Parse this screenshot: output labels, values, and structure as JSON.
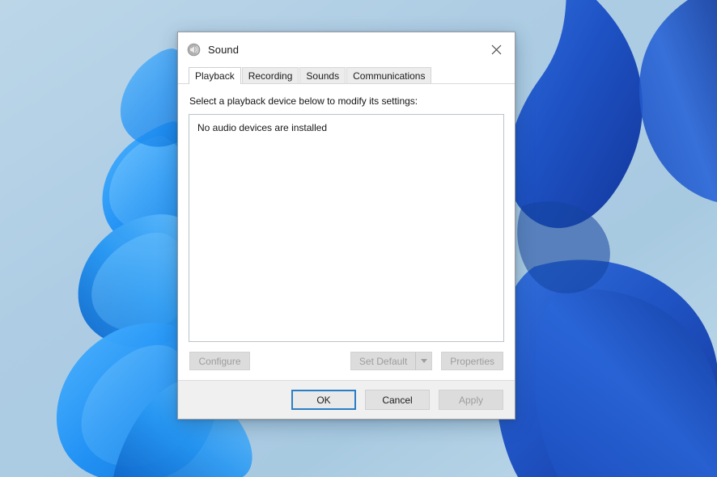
{
  "desktop": {
    "wallpaper_name": "windows-11-bloom-wallpaper",
    "background_top": "#b9d3e6",
    "background_bottom": "#bcd7e8",
    "bloom_light": "#2c9cf5",
    "bloom_mid": "#1f7ae0",
    "bloom_dark": "#1447bd"
  },
  "dialog": {
    "title": "Sound",
    "icon": "speaker-icon",
    "close_label": "Close",
    "tabs": [
      {
        "label": "Playback",
        "active": true
      },
      {
        "label": "Recording",
        "active": false
      },
      {
        "label": "Sounds",
        "active": false
      },
      {
        "label": "Communications",
        "active": false
      }
    ],
    "content": {
      "prompt": "Select a playback device below to modify its settings:",
      "device_list": {
        "items": [],
        "empty_message": "No audio devices are installed"
      }
    },
    "actions": {
      "configure": {
        "label": "Configure",
        "enabled": false
      },
      "set_default": {
        "label": "Set Default",
        "enabled": false,
        "has_dropdown": true
      },
      "properties": {
        "label": "Properties",
        "enabled": false
      }
    },
    "footer": {
      "ok": {
        "label": "OK",
        "enabled": true,
        "is_default": true
      },
      "cancel": {
        "label": "Cancel",
        "enabled": true,
        "is_default": false
      },
      "apply": {
        "label": "Apply",
        "enabled": false,
        "is_default": false
      }
    },
    "accent_color": "#2a7ec4"
  }
}
